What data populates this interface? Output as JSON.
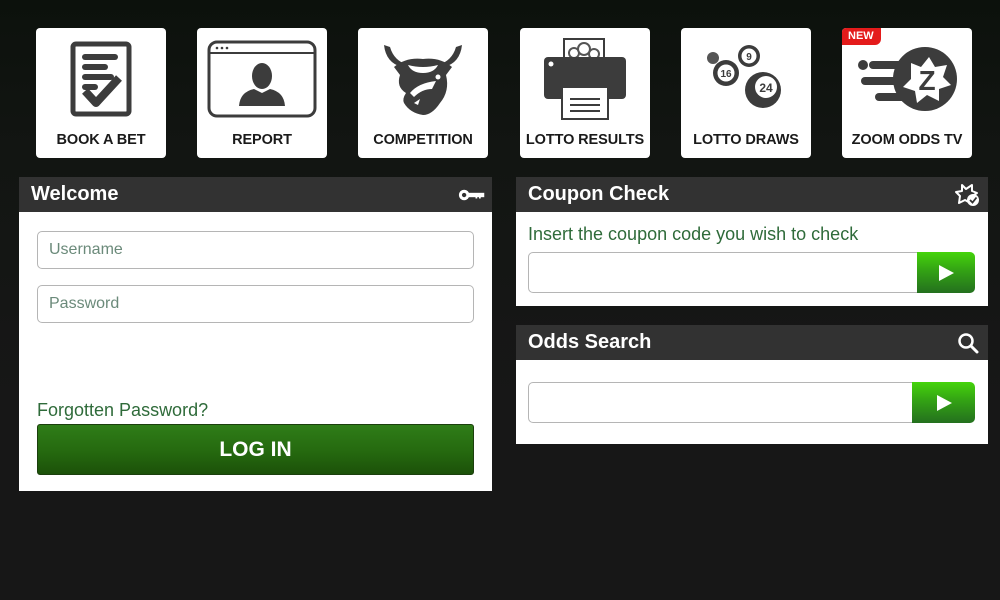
{
  "tiles": [
    {
      "label": "BOOK A BET",
      "icon": "bet-slip-check-icon"
    },
    {
      "label": "REPORT",
      "icon": "browser-user-icon"
    },
    {
      "label": "COMPETITION",
      "icon": "bull-head-icon"
    },
    {
      "label": "LOTTO RESULTS",
      "icon": "printer-lotto-icon"
    },
    {
      "label": "LOTTO DRAWS",
      "icon": "lotto-balls-icon",
      "balls": [
        "16",
        "9",
        "24"
      ]
    },
    {
      "label": "ZOOM ODDS TV",
      "icon": "zoom-odds-icon",
      "badge": "NEW",
      "glyph": "Z"
    }
  ],
  "welcome": {
    "title": "Welcome",
    "header_icon": "key-icon",
    "username_placeholder": "Username",
    "password_placeholder": "Password",
    "forgot_label": "Forgotten Password?",
    "login_label": "LOG IN"
  },
  "coupon": {
    "title": "Coupon Check",
    "header_icon": "ticket-check-icon",
    "hint": "Insert the coupon code you wish to check",
    "value": "",
    "submit_icon": "play-icon"
  },
  "odds": {
    "title": "Odds Search",
    "header_icon": "search-icon",
    "value": "",
    "submit_icon": "play-icon"
  },
  "colors": {
    "accent_green": "#2f7d18",
    "go_green": "#45d40b",
    "badge_red": "#e41b1b",
    "header_dark": "#323232",
    "hint_green": "#2f6b3a"
  }
}
